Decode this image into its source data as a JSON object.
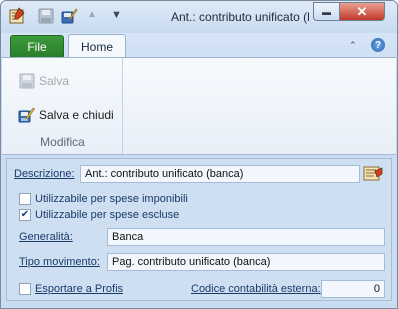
{
  "window": {
    "title": "Ant.: contributo unificato (banca)",
    "minimize_glyph": "▬",
    "close_glyph": "✕"
  },
  "quick_access": {
    "up_glyph": "▲",
    "dropdown_glyph": "▼"
  },
  "tabs": {
    "file": "File",
    "home": "Home"
  },
  "ribbon": {
    "collapse_glyph": "⌃",
    "help_glyph": "?",
    "group_label": "Modifica",
    "salva": "Salva",
    "salva_chiudi": "Salva e chiudi"
  },
  "form": {
    "descrizione_label": "Descrizione:",
    "descrizione_value": "Ant.: contributo unificato (banca)",
    "utilizzabile_imponibili": {
      "label": "Utilizzabile per spese imponibili",
      "checked": false
    },
    "utilizzabile_escluse": {
      "label": "Utilizzabile per spese escluse",
      "checked": true
    },
    "generalita_label": "Generalità:",
    "generalita_value": "Banca",
    "tipo_movimento_label": "Tipo movimento:",
    "tipo_movimento_value": "Pag. contributo unificato (banca)",
    "esportare_label": "Esportare a Profis",
    "esportare_checked": false,
    "codice_label": "Codice contabilità esterna:",
    "codice_value": "0",
    "check_glyph": "✔"
  },
  "colors": {
    "file_tab": "#2a7f2a",
    "label_text": "#1a3a6a",
    "close_button": "#c2392a"
  }
}
